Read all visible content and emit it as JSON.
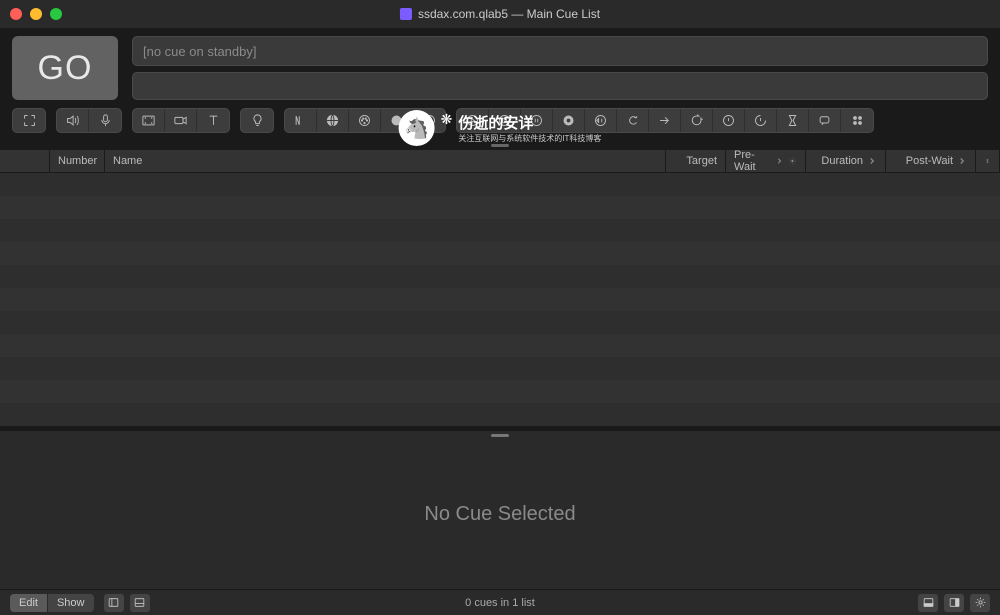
{
  "window": {
    "title": "ssdax.com.qlab5 — Main Cue List"
  },
  "go_button": {
    "label": "GO"
  },
  "standby": {
    "placeholder": "[no cue on standby]"
  },
  "watermark": {
    "title": "伤逝的安详",
    "subtitle": "关注互联网与系统软件技术的IT科技博客"
  },
  "columns": {
    "number": "Number",
    "name": "Name",
    "target": "Target",
    "prewait": "Pre-Wait",
    "duration": "Duration",
    "postwait": "Post-Wait"
  },
  "inspector": {
    "empty_message": "No Cue Selected"
  },
  "footer": {
    "mode_edit": "Edit",
    "mode_show": "Show",
    "status": "0 cues in 1 list"
  }
}
